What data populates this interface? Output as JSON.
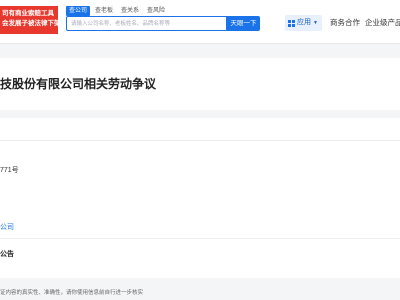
{
  "promo": {
    "line1": "司有商业索赔工具",
    "line2": "会发展子被法律下架的"
  },
  "search": {
    "tabs": [
      "查公司",
      "查老板",
      "查关系",
      "查风险"
    ],
    "placeholder": "请输入公司名称、老板姓名、品牌名称等",
    "button_label": "天眼一下"
  },
  "nav": {
    "apps_label": "应用",
    "business_label": "商务合作",
    "enterprise_label": "企业级产品"
  },
  "page": {
    "title": "技股份有限公司相关劳动争议"
  },
  "detail": {
    "case_number": "771号",
    "company_link": "公司",
    "section_label": "公告"
  },
  "footer": {
    "disclaimer": "证内容的真实性、准确性，请你使用信息前自行进一步核实"
  },
  "colors": {
    "accent": "#1a73e8",
    "promo": "#e8372d"
  }
}
